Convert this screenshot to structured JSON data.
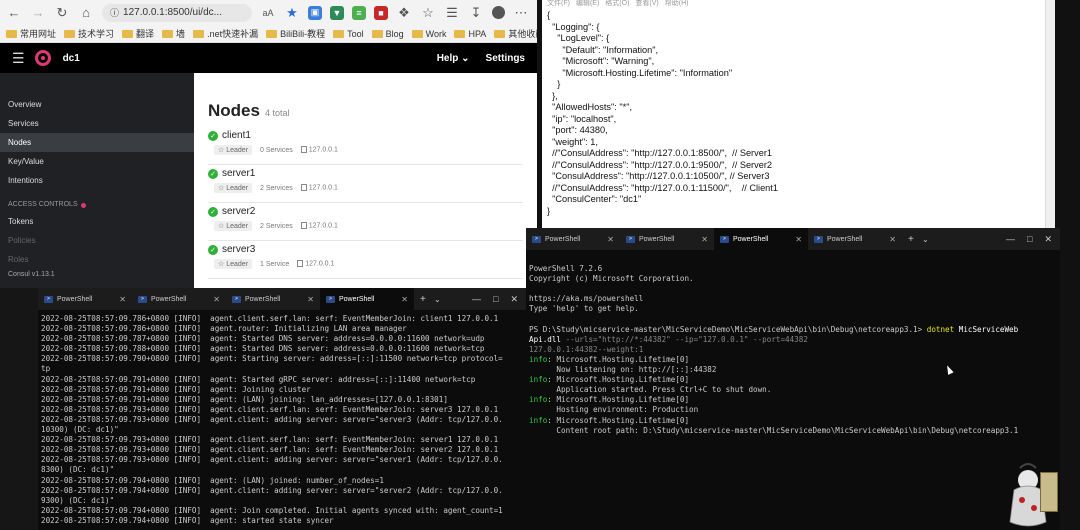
{
  "browser": {
    "url": "127.0.0.1:8500/ui/dc...",
    "url_suffix": "aʘ",
    "bookmarks": [
      "常用网址",
      "技术学习",
      "翻译",
      "墙",
      ".net快速补漏",
      "BiliBili-教程",
      "Tool",
      "Blog",
      "Work",
      "HPA"
    ],
    "bookmarks_other": "其他收藏夹"
  },
  "consul": {
    "dc": "dc1",
    "help": "Help",
    "settings": "Settings",
    "nav": [
      "Overview",
      "Services",
      "Nodes",
      "Key/Value",
      "Intentions"
    ],
    "access_controls": "ACCESS CONTROLS",
    "acl_nav": [
      "Tokens",
      "Policies",
      "Roles"
    ],
    "version": "Consul v1.13.1",
    "page_title": "Nodes",
    "page_count": "4 total",
    "nodes": [
      {
        "name": "client1",
        "leader": "Leader",
        "services": "0 Services",
        "ip": "127.0.0.1"
      },
      {
        "name": "server1",
        "leader": "Leader",
        "services": "2 Services",
        "ip": "127.0.0.1"
      },
      {
        "name": "server2",
        "leader": "Leader",
        "services": "2 Services",
        "ip": "127.0.0.1"
      },
      {
        "name": "server3",
        "leader": "Leader",
        "services": "1 Service",
        "ip": "127.0.0.1"
      }
    ]
  },
  "notepad": {
    "menu": [
      "文件(F)",
      "编辑(E)",
      "格式(O)",
      "查看(V)",
      "帮助(H)"
    ],
    "content": "{\n  \"Logging\": {\n    \"LogLevel\": {\n      \"Default\": \"Information\",\n      \"Microsoft\": \"Warning\",\n      \"Microsoft.Hosting.Lifetime\": \"Information\"\n    }\n  },\n  \"AllowedHosts\": \"*\",\n  \"ip\": \"localhost\",\n  \"port\": 44380,\n  \"weight\": 1,\n  //\"ConsulAddress\": \"http://127.0.0.1:8500/\",  // Server1\n  //\"ConsulAddress\": \"http://127.0.0.1:9500/\",  // Server2\n  \"ConsulAddress\": \"http://127.0.0.1:10500/\", // Server3\n  //\"ConsulAddress\": \"http://127.0.0.1:11500/\",    // Client1\n  \"ConsulCenter\": \"dc1\"\n}"
  },
  "terminal_left": {
    "tabs": [
      "PowerShell",
      "PowerShell",
      "PowerShell",
      "PowerShell"
    ],
    "active_tab": 3,
    "lines": [
      "2022-08-25T08:57:09.786+0800 [INFO]  agent.client.serf.lan: serf: EventMemberJoin: client1 127.0.0.1",
      "2022-08-25T08:57:09.786+0800 [INFO]  agent.router: Initializing LAN area manager",
      "2022-08-25T08:57:09.787+0800 [INFO]  agent: Started DNS server: address=0.0.0.0:11600 network=udp",
      "2022-08-25T08:57:09.788+0800 [INFO]  agent: Started DNS server: address=0.0.0.0:11600 network=tcp",
      "2022-08-25T08:57:09.790+0800 [INFO]  agent: Starting server: address=[::]:11500 network=tcp protocol=",
      "tp",
      "2022-08-25T08:57:09.791+0800 [INFO]  agent: Started gRPC server: address=[::]:11400 network=tcp",
      "2022-08-25T08:57:09.791+0800 [INFO]  agent: Joining cluster",
      "2022-08-25T08:57:09.791+0800 [INFO]  agent: (LAN) joining: lan_addresses=[127.0.0.1:8301]",
      "2022-08-25T08:57:09.793+0800 [INFO]  agent.client.serf.lan: serf: EventMemberJoin: server3 127.0.0.1",
      "2022-08-25T08:57:09.793+0800 [INFO]  agent.client: adding server: server=\"server3 (Addr: tcp/127.0.0.",
      "10300) (DC: dc1)\"",
      "2022-08-25T08:57:09.793+0800 [INFO]  agent.client.serf.lan: serf: EventMemberJoin: server1 127.0.0.1",
      "2022-08-25T08:57:09.793+0800 [INFO]  agent.client.serf.lan: serf: EventMemberJoin: server2 127.0.0.1",
      "2022-08-25T08:57:09.793+0800 [INFO]  agent.client: adding server: server=\"server1 (Addr: tcp/127.0.0.",
      "8300) (DC: dc1)\"",
      "2022-08-25T08:57:09.794+0800 [INFO]  agent: (LAN) joined: number_of_nodes=1",
      "2022-08-25T08:57:09.794+0800 [INFO]  agent.client: adding server: server=\"server2 (Addr: tcp/127.0.0.",
      "9300) (DC: dc1)\"",
      "2022-08-25T08:57:09.794+0800 [INFO]  agent: Join completed. Initial agents synced with: agent_count=1",
      "2022-08-25T08:57:09.794+0800 [INFO]  agent: started state syncer"
    ]
  },
  "terminal_right": {
    "tabs": [
      "PowerShell",
      "PowerShell",
      "PowerShell",
      "PowerShell"
    ],
    "active_tab": 2,
    "banner1": "PowerShell 7.2.6",
    "banner2": "Copyright (c) Microsoft Corporation.",
    "link": "https://aka.ms/powershell",
    "help": "Type 'help' to get help.",
    "prompt": "PS D:\\Study\\micservice-master\\MicServiceDemo\\MicServiceWebApi\\bin\\Debug\\netcoreapp3.1> ",
    "cmd": "dotnet",
    "cmd_rest": " MicServiceWeb",
    "cmd_line2a": "Api.dll",
    "cmd_line2b": " --urls=\"http://*:44382\" --ip=\"127.0.0.1\" --port=44382",
    "cmd_line3": "127.0.0.1:44382--weight:1",
    "logs": [
      {
        "level": "info",
        "text": ": Microsoft.Hosting.Lifetime[0]"
      },
      {
        "level": "",
        "text": "      Now listening on: http://[::]:44382"
      },
      {
        "level": "info",
        "text": ": Microsoft.Hosting.Lifetime[0]"
      },
      {
        "level": "",
        "text": "      Application started. Press Ctrl+C to shut down."
      },
      {
        "level": "info",
        "text": ": Microsoft.Hosting.Lifetime[0]"
      },
      {
        "level": "",
        "text": "      Hosting environment: Production"
      },
      {
        "level": "info",
        "text": ": Microsoft.Hosting.Lifetime[0]"
      },
      {
        "level": "",
        "text": "      Content root path: D:\\Study\\micservice-master\\MicServiceDemo\\MicServiceWebApi\\bin\\Debug\\netcoreapp3.1"
      }
    ]
  },
  "colors": {
    "consul_brand": "#e03875",
    "healthy": "#2eb039",
    "terminal_bg": "#0c0c0c",
    "info_green": "#2ecc40",
    "cmd_yellow": "#e5e510"
  },
  "icons": {
    "back": "arrow-left-icon",
    "forward": "arrow-right-icon",
    "refresh": "refresh-icon",
    "home": "home-icon",
    "menu": "hamburger-icon",
    "health": "check-circle-icon",
    "leader": "star-icon",
    "close": "close-icon"
  }
}
